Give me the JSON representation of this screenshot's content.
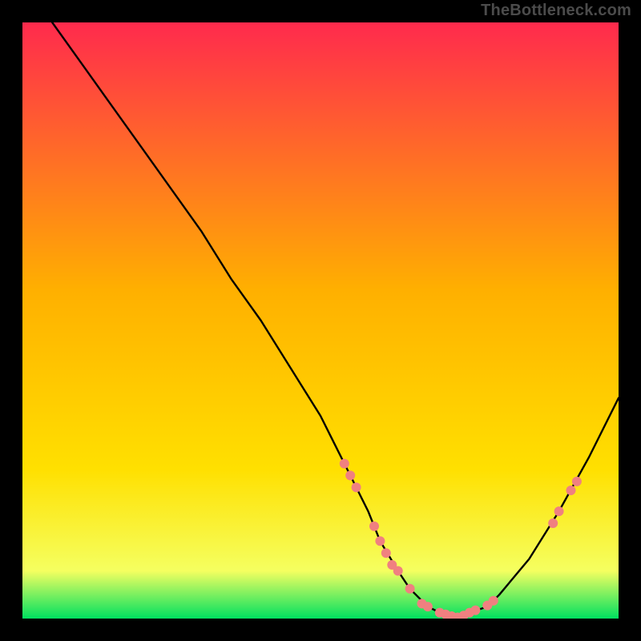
{
  "branding": "TheBottleneck.com",
  "chart_data": {
    "type": "line",
    "title": "",
    "xlabel": "",
    "ylabel": "",
    "xlim": [
      0,
      100
    ],
    "ylim": [
      0,
      100
    ],
    "grid": false,
    "legend": false,
    "background_gradient": {
      "top": "#ff2a4d",
      "mid": "#ffd400",
      "bottom": "#00e060"
    },
    "series": [
      {
        "name": "bottleneck-curve",
        "stroke": "#000000",
        "x": [
          5,
          10,
          15,
          20,
          25,
          30,
          35,
          40,
          45,
          50,
          52,
          55,
          58,
          60,
          63,
          65,
          68,
          70,
          73,
          75,
          78,
          80,
          85,
          90,
          95,
          100
        ],
        "y": [
          100,
          93,
          86,
          79,
          72,
          65,
          57,
          50,
          42,
          34,
          30,
          24,
          18,
          13,
          8,
          5,
          2,
          1,
          0,
          1,
          2,
          4,
          10,
          18,
          27,
          37
        ]
      }
    ],
    "markers": {
      "name": "highlighted-points",
      "color": "#f08080",
      "points": [
        {
          "x": 54,
          "y": 26
        },
        {
          "x": 55,
          "y": 24
        },
        {
          "x": 56,
          "y": 22
        },
        {
          "x": 59,
          "y": 15.5
        },
        {
          "x": 60,
          "y": 13
        },
        {
          "x": 61,
          "y": 11
        },
        {
          "x": 62,
          "y": 9
        },
        {
          "x": 63,
          "y": 8
        },
        {
          "x": 65,
          "y": 5
        },
        {
          "x": 67,
          "y": 2.5
        },
        {
          "x": 68,
          "y": 2
        },
        {
          "x": 70,
          "y": 1
        },
        {
          "x": 71,
          "y": 0.7
        },
        {
          "x": 72,
          "y": 0.4
        },
        {
          "x": 73,
          "y": 0.2
        },
        {
          "x": 74,
          "y": 0.5
        },
        {
          "x": 75,
          "y": 1
        },
        {
          "x": 76,
          "y": 1.4
        },
        {
          "x": 78,
          "y": 2.2
        },
        {
          "x": 79,
          "y": 3
        },
        {
          "x": 89,
          "y": 16
        },
        {
          "x": 90,
          "y": 18
        },
        {
          "x": 92,
          "y": 21.5
        },
        {
          "x": 93,
          "y": 23
        }
      ]
    }
  }
}
